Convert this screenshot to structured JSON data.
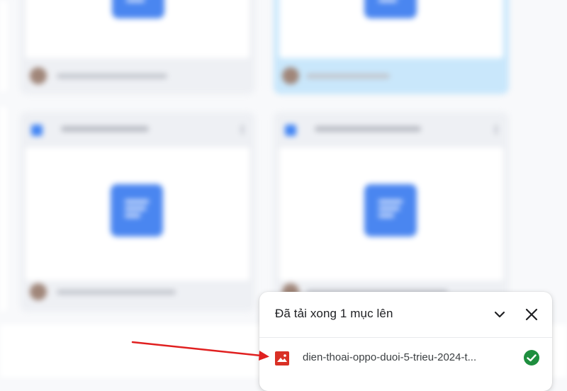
{
  "upload_panel": {
    "title": "Đã tải xong 1 mục lên",
    "collapse_icon": "chevron-down-icon",
    "close_icon": "close-icon",
    "file": {
      "name": "dien-thoai-oppo-duoi-5-trieu-2024-t...",
      "type_icon": "image-file-icon",
      "status_icon": "check-circle-icon"
    }
  },
  "colors": {
    "doc_blue": "#4a86f0",
    "selected_card": "#c9e7fb",
    "image_icon_red": "#d93025",
    "success_green": "#1e8e3e",
    "annotation_arrow": "#e02020"
  }
}
